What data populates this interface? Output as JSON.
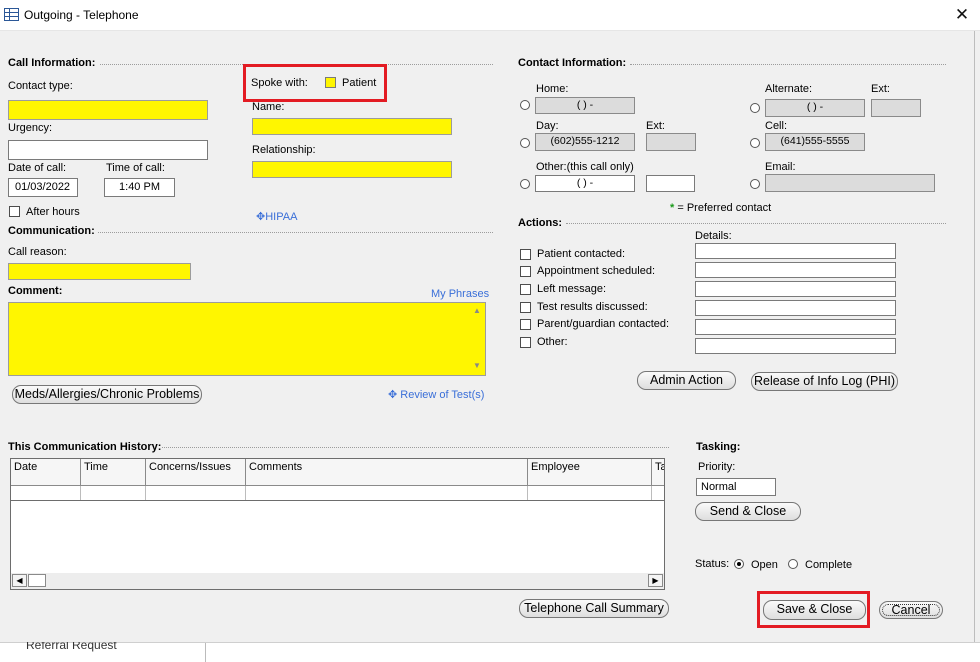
{
  "window": {
    "title": "Outgoing - Telephone"
  },
  "call_info": {
    "section": "Call Information:",
    "contact_type_label": "Contact type:",
    "urgency_label": "Urgency:",
    "date_label": "Date of call:",
    "date_value": "01/03/2022",
    "time_label": "Time of call:",
    "time_value": "1:40 PM",
    "after_hours_label": "After hours",
    "spoke_with_label": "Spoke with:",
    "patient_label": "Patient",
    "name_label": "Name:",
    "relationship_label": "Relationship:",
    "hipaa_link": "HIPAA"
  },
  "communication": {
    "section": "Communication:",
    "call_reason_label": "Call reason:",
    "comment_label": "Comment:",
    "my_phrases_link": "My Phrases",
    "meds_button": "Meds/Allergies/Chronic Problems",
    "review_tests_link": "Review of Test(s)"
  },
  "contact_info": {
    "section": "Contact Information:",
    "home_label": "Home:",
    "home_value": "(   )   -",
    "day_label": "Day:",
    "day_value": "(602)555-1212",
    "ext_label": "Ext:",
    "other_label": "Other:",
    "other_note": "(this call only)",
    "other_value": "(   )   -",
    "alternate_label": "Alternate:",
    "alternate_value": "(   )   -",
    "alt_ext_label": "Ext:",
    "cell_label": "Cell:",
    "cell_value": "(641)555-5555",
    "email_label": "Email:",
    "preferred_mark": "*",
    "preferred_text": "= Preferred contact"
  },
  "actions": {
    "section": "Actions:",
    "details_label": "Details:",
    "items": [
      "Patient contacted:",
      "Appointment scheduled:",
      "Left message:",
      "Test results discussed:",
      "Parent/guardian contacted:",
      "Other:"
    ],
    "admin_action_button": "Admin Action",
    "release_log_button": "Release of Info Log (PHI)"
  },
  "history": {
    "section": "This Communication History:",
    "columns": [
      "Date",
      "Time",
      "Concerns/Issues",
      "Comments",
      "Employee",
      "Ta"
    ],
    "summary_button": "Telephone Call Summary"
  },
  "tasking": {
    "section": "Tasking:",
    "priority_label": "Priority:",
    "priority_value": "Normal",
    "send_close_button": "Send & Close",
    "status_label": "Status:",
    "status_open": "Open",
    "status_complete": "Complete"
  },
  "footer": {
    "save_close_button": "Save & Close",
    "cancel_button": "Cancel",
    "background_text": "Referral Request"
  },
  "colors": {
    "required_field": "#fff600",
    "highlight_box": "#e31b23",
    "link": "#3a6fd8",
    "preferred_star": "#1a9a1a"
  }
}
